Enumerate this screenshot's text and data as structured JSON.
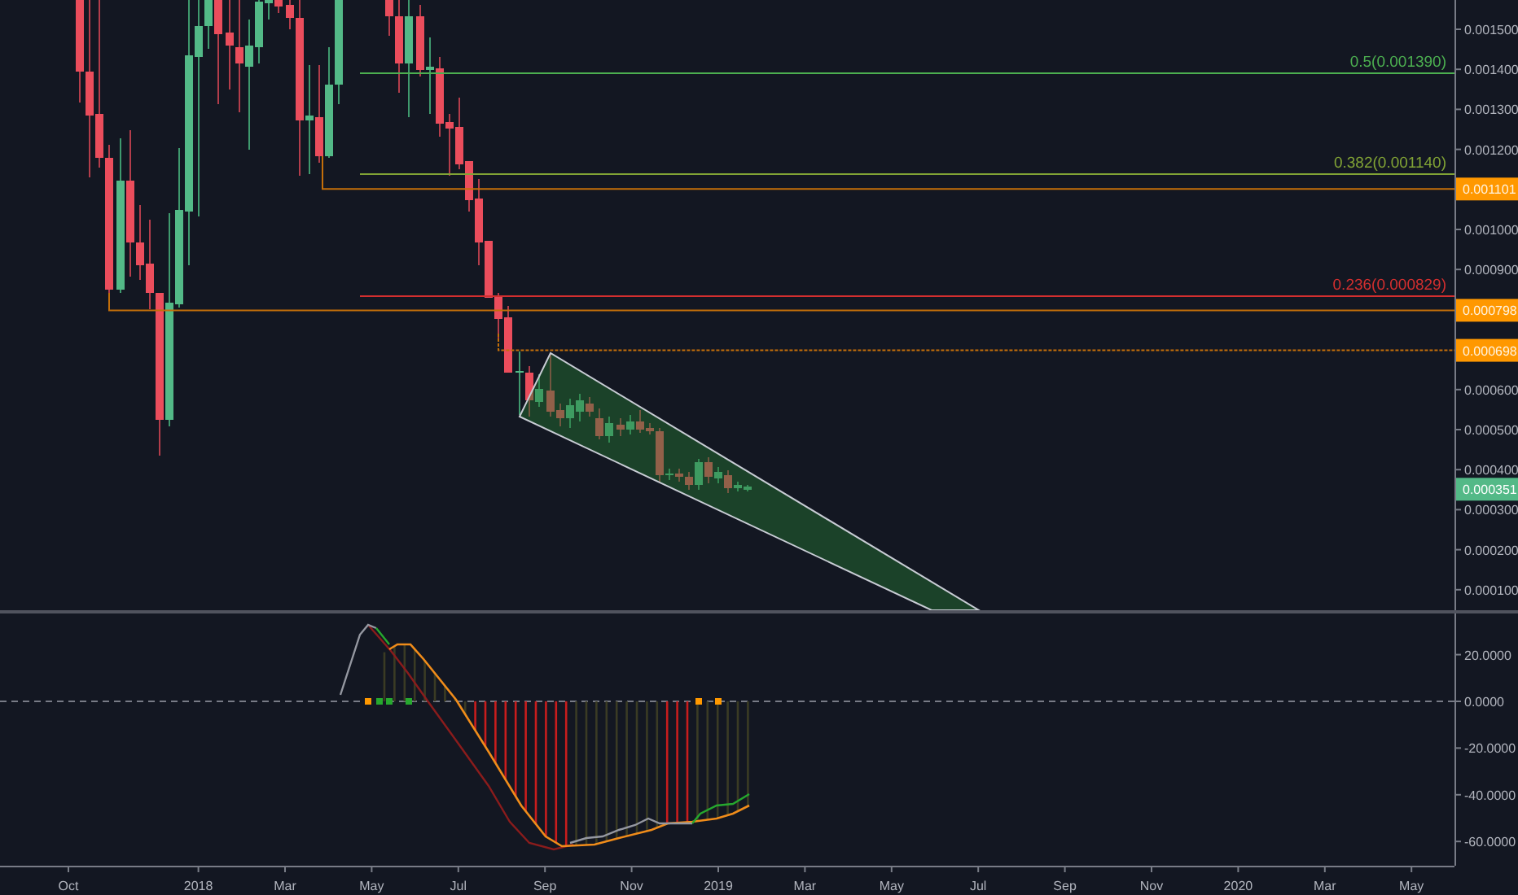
{
  "price_axis": {
    "ticks": [
      "0.001500",
      "0.001400",
      "0.001300",
      "0.001200",
      "0.001000",
      "0.000900",
      "0.000600",
      "0.000500",
      "0.000400",
      "0.000300",
      "0.000200",
      "0.000100"
    ]
  },
  "fib_levels": [
    {
      "label": "0.5(0.001390)",
      "color": "#4caf50"
    },
    {
      "label": "0.382(0.001140)",
      "color": "#81a335"
    },
    {
      "label": "0.236(0.000829)",
      "color": "#d32f2f"
    }
  ],
  "price_tags": [
    {
      "text": "0.001101",
      "kind": "level"
    },
    {
      "text": "0.000798",
      "kind": "level"
    },
    {
      "text": "0.000698",
      "kind": "level"
    },
    {
      "text": "0.000351",
      "kind": "last"
    }
  ],
  "indicator_axis": {
    "ticks": [
      "20.0000",
      "0.0000",
      "-20.0000",
      "-40.0000",
      "-60.0000"
    ]
  },
  "time_axis": {
    "labels": [
      "Oct",
      "2018",
      "Mar",
      "May",
      "Jul",
      "Sep",
      "Nov",
      "2019",
      "Mar",
      "May",
      "Jul",
      "Sep",
      "Nov",
      "2020",
      "Mar",
      "May"
    ]
  }
}
